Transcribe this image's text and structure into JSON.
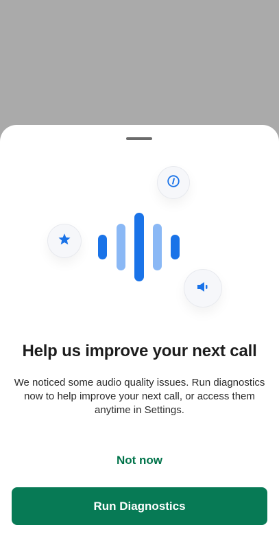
{
  "dialog": {
    "title": "Help us improve your next call",
    "message": "We noticed some audio quality issues. Run diagnostics now to help improve your next call, or access them anytime in Settings.",
    "secondary_label": "Not now",
    "primary_label": "Run Diagnostics"
  },
  "colors": {
    "accent_blue": "#1a73e8",
    "light_blue": "#8ab8f5",
    "primary_green": "#077a55",
    "link_green": "#00734a",
    "backdrop": "#aaaaaa"
  },
  "icons": [
    "star-icon",
    "info-icon",
    "speaker-icon",
    "audio-waveform"
  ]
}
